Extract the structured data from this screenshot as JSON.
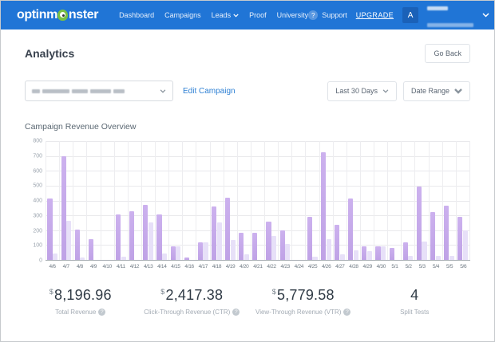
{
  "topbar": {
    "brand": "optinmonster",
    "brand_prefix": "optinm",
    "brand_suffix": "nster",
    "nav_items": [
      {
        "label": "Dashboard",
        "caret": false
      },
      {
        "label": "Campaigns",
        "caret": false
      },
      {
        "label": "Leads",
        "caret": true
      },
      {
        "label": "Proof",
        "caret": false
      },
      {
        "label": "University",
        "caret": false
      }
    ],
    "support_label": "Support",
    "support_icon_glyph": "?",
    "upgrade_label": "UPGRADE",
    "avatar_initial": "A"
  },
  "header": {
    "title": "Analytics",
    "go_back_label": "Go Back"
  },
  "toolbar": {
    "edit_campaign_label": "Edit Campaign",
    "period_label": "Last 30 Days",
    "date_range_label": "Date Range"
  },
  "section": {
    "title": "Campaign Revenue Overview"
  },
  "chart_data": {
    "type": "bar",
    "title": "Campaign Revenue Overview",
    "x": [
      "4/6",
      "4/7",
      "4/8",
      "4/9",
      "4/10",
      "4/11",
      "4/12",
      "4/13",
      "4/14",
      "4/15",
      "4/16",
      "4/17",
      "4/18",
      "4/19",
      "4/20",
      "4/21",
      "4/22",
      "4/23",
      "4/24",
      "4/25",
      "4/26",
      "4/27",
      "4/28",
      "4/29",
      "4/30",
      "5/1",
      "5/2",
      "5/3",
      "5/4",
      "5/5",
      "5/6"
    ],
    "series": [
      {
        "name": "primary",
        "color": "#bfa2e6",
        "values": [
          415,
          700,
          205,
          140,
          0,
          305,
          325,
          370,
          305,
          90,
          15,
          120,
          360,
          420,
          180,
          180,
          260,
          200,
          0,
          290,
          725,
          235,
          415,
          90,
          90,
          80,
          120,
          495,
          320,
          365,
          290
        ]
      },
      {
        "name": "secondary",
        "color": "#e7e0f8",
        "values": [
          45,
          265,
          15,
          0,
          0,
          20,
          0,
          255,
          45,
          90,
          0,
          120,
          250,
          135,
          40,
          0,
          160,
          110,
          0,
          20,
          140,
          35,
          65,
          60,
          90,
          0,
          25,
          125,
          25,
          25,
          200
        ]
      }
    ],
    "ylim": [
      0,
      800
    ],
    "ytick_step": 100,
    "grid": true,
    "legend": "none"
  },
  "stats": {
    "items": [
      {
        "currency": "$",
        "value": "8,196.96",
        "label": "Total Revenue",
        "help": true
      },
      {
        "currency": "$",
        "value": "2,417.38",
        "label": "Click-Through Revenue (CTR)",
        "help": true
      },
      {
        "currency": "$",
        "value": "5,779.58",
        "label": "View-Through Revenue (VTR)",
        "help": true
      },
      {
        "currency": "",
        "value": "4",
        "label": "Split Tests",
        "help": false
      }
    ]
  },
  "colors": {
    "topbar_blue": "#2075d6",
    "brand_green": "#7ac143",
    "bar_primary": "#bfa2e6",
    "bar_secondary": "#e7e0f8",
    "link_blue": "#2e80d4"
  }
}
